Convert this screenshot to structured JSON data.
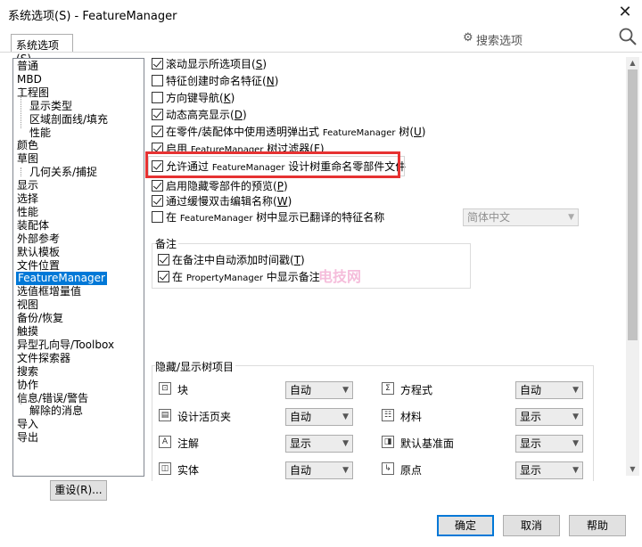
{
  "window": {
    "title": "系统选项(S) - FeatureManager",
    "close_glyph": "✕"
  },
  "tab": {
    "label": "系统选项",
    "mnemonic": "S"
  },
  "search": {
    "placeholder": "搜索选项"
  },
  "tree": {
    "items": [
      {
        "label": "普通",
        "level": 0
      },
      {
        "label": "MBD",
        "level": 0
      },
      {
        "label": "工程图",
        "level": 0
      },
      {
        "label": "显示类型",
        "level": 1
      },
      {
        "label": "区域剖面线/填充",
        "level": 1
      },
      {
        "label": "性能",
        "level": 1
      },
      {
        "label": "颜色",
        "level": 0
      },
      {
        "label": "草图",
        "level": 0
      },
      {
        "label": "几何关系/捕捉",
        "level": 1
      },
      {
        "label": "显示",
        "level": 0
      },
      {
        "label": "选择",
        "level": 0
      },
      {
        "label": "性能",
        "level": 0
      },
      {
        "label": "装配体",
        "level": 0
      },
      {
        "label": "外部参考",
        "level": 0
      },
      {
        "label": "默认模板",
        "level": 0
      },
      {
        "label": "文件位置",
        "level": 0
      },
      {
        "label": "FeatureManager",
        "level": 0,
        "selected": true
      },
      {
        "label": "选值框增量值",
        "level": 0
      },
      {
        "label": "视图",
        "level": 0
      },
      {
        "label": "备份/恢复",
        "level": 0
      },
      {
        "label": "触摸",
        "level": 0
      },
      {
        "label": "异型孔向导/Toolbox",
        "level": 0
      },
      {
        "label": "文件探索器",
        "level": 0
      },
      {
        "label": "搜索",
        "level": 0
      },
      {
        "label": "协作",
        "level": 0
      },
      {
        "label": "信息/错误/警告",
        "level": 0
      },
      {
        "label": "解除的消息",
        "level": 1
      },
      {
        "label": "导入",
        "level": 0
      },
      {
        "label": "导出",
        "level": 0
      }
    ],
    "reset_button": "重设(R)..."
  },
  "options": [
    {
      "pre": "滚动显示所选项目",
      "small": "",
      "post": "",
      "key": "S",
      "checked": true
    },
    {
      "pre": "特征创建时命名特征",
      "small": "",
      "post": "",
      "key": "N",
      "checked": false
    },
    {
      "pre": "方向键导航",
      "small": "",
      "post": "",
      "key": "K",
      "checked": false
    },
    {
      "pre": "动态高亮显示",
      "small": "",
      "post": "",
      "key": "D",
      "checked": true
    },
    {
      "pre": "在零件/装配体中使用透明弹出式 ",
      "small": "FeatureManager",
      "post": " 树",
      "key": "U",
      "checked": true
    },
    {
      "pre": "启用 ",
      "small": "FeatureManager",
      "post": " 树过滤器",
      "key": "F",
      "checked": true
    },
    {
      "pre": "允许通过 ",
      "small": "FeatureManager",
      "post": " 设计树重命名零部件文件",
      "key": "",
      "checked": true
    },
    {
      "pre": "启用隐藏零部件的预览",
      "small": "",
      "post": "",
      "key": "P",
      "checked": true
    },
    {
      "pre": "通过缓慢双击编辑名称",
      "small": "",
      "post": "",
      "key": "W",
      "checked": true
    },
    {
      "pre": "在 ",
      "small": "FeatureManager",
      "post": " 树中显示已翻译的特征名称",
      "key": "",
      "checked": false
    }
  ],
  "language_dropdown": {
    "value": "简体中文"
  },
  "notes_group": {
    "label": "备注",
    "options": [
      {
        "pre": "在备注中自动添加时间戳",
        "small": "",
        "post": "",
        "key": "T",
        "checked": true
      },
      {
        "pre": "在 ",
        "small": "PropertyManager",
        "post": " 中显示备注",
        "key": "",
        "checked": true
      }
    ]
  },
  "watermark": "电技网",
  "hide_show_group": {
    "label": "隐藏/显示树项目",
    "items": [
      {
        "label": "块",
        "icon": "block-icon",
        "glyph": "⊡",
        "value": "自动"
      },
      {
        "label": "方程式",
        "icon": "equation-icon",
        "glyph": "Σ",
        "value": "自动"
      },
      {
        "label": "设计活页夹",
        "icon": "design-binder-icon",
        "glyph": "▤",
        "value": "自动"
      },
      {
        "label": "材料",
        "icon": "material-icon",
        "glyph": "☷",
        "value": "显示"
      },
      {
        "label": "注解",
        "icon": "annotation-icon",
        "glyph": "A",
        "value": "显示"
      },
      {
        "label": "默认基准面",
        "icon": "default-plane-icon",
        "glyph": "◨",
        "value": "显示"
      },
      {
        "label": "实体",
        "icon": "solid-body-icon",
        "glyph": "◫",
        "value": "自动"
      },
      {
        "label": "原点",
        "icon": "origin-icon",
        "glyph": "↳",
        "value": "显示"
      }
    ]
  },
  "buttons": {
    "ok": "确定",
    "cancel": "取消",
    "help": "帮助"
  },
  "colors": {
    "highlight_box": "#e63232",
    "selection": "#0078d7"
  }
}
